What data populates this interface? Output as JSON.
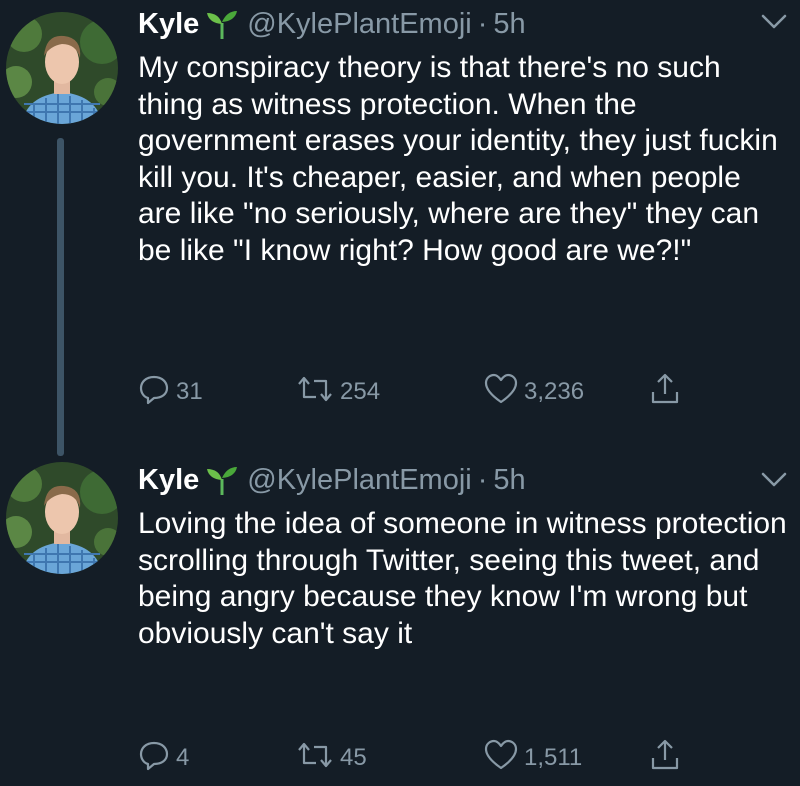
{
  "tweets": [
    {
      "name": "Kyle",
      "handle": "@KylePlantEmoji",
      "separator": "·",
      "time": "5h",
      "text": "My conspiracy theory is that there's no such thing as witness protection. When the government erases your identity, they just fuckin kill you. It's cheaper, easier, and when people are like \"no seriously, where are they\" they can be like \"I know right? How good are we?!\"",
      "replies": "31",
      "retweets": "254",
      "likes": "3,236"
    },
    {
      "name": "Kyle",
      "handle": "@KylePlantEmoji",
      "separator": "·",
      "time": "5h",
      "text": "Loving the idea of someone in witness protection scrolling through Twitter, seeing this tweet, and being angry because they know I'm wrong but obviously can't say it",
      "replies": "4",
      "retweets": "45",
      "likes": "1,511"
    }
  ],
  "icons": {
    "name_emoji": "seedling-icon",
    "menu": "chevron-down-icon",
    "reply": "reply-icon",
    "retweet": "retweet-icon",
    "like": "heart-icon",
    "share": "share-icon"
  },
  "colors": {
    "background": "#141d26",
    "text": "#ffffff",
    "secondary": "#8899a6",
    "thread_line": "#3d5466",
    "sprout": "#5cb85c"
  }
}
